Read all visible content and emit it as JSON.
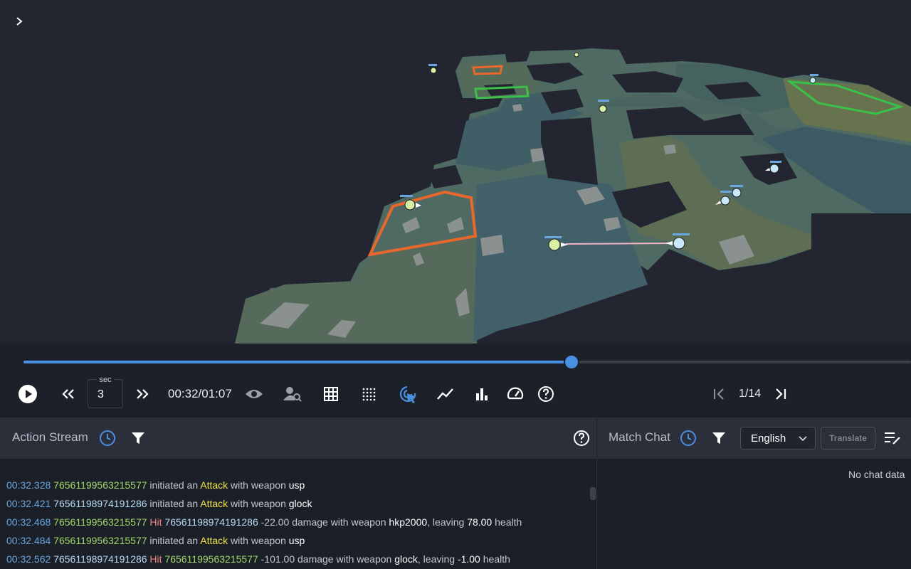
{
  "viewport": {
    "expand_icon": "chevron-right-icon",
    "player_markers": [
      {
        "team": "t",
        "color": "#d9f0a3"
      },
      {
        "team": "t",
        "color": "#d9f0a3"
      },
      {
        "team": "ct",
        "color": "#c7e9fb"
      },
      {
        "team": "ct",
        "color": "#c7e9fb"
      },
      {
        "team": "ct",
        "color": "#c7e9fb"
      },
      {
        "team": "ct",
        "color": "#c7e9fb"
      },
      {
        "team": "t",
        "color": "#d9f0a3"
      },
      {
        "team": "t",
        "color": "#d9f0a3"
      },
      {
        "team": "ct",
        "color": "#c7e9fb"
      }
    ]
  },
  "timeline": {
    "progress": 0.6175,
    "sec_label": "sec",
    "sec_value": "3",
    "timecode": "00:32/01:07",
    "page_indicator": "1/14",
    "accent": "#4a90e2"
  },
  "controls": {
    "icons": [
      "play-icon",
      "rewind-icon",
      "fast-forward-icon",
      "eye-icon",
      "user-search-icon",
      "grid-icon",
      "dot-grid-icon",
      "cursor-target-icon",
      "line-chart-icon",
      "bar-chart-icon",
      "speedometer-icon",
      "help-icon",
      "skip-first-icon",
      "skip-last-icon"
    ]
  },
  "action_stream": {
    "title": "Action Stream",
    "log": [
      [
        {
          "c": "t-time",
          "t": "00:32.328"
        },
        {
          "c": "t-p1",
          "t": " 76561199563215577"
        },
        {
          "c": "",
          "t": " initiated an "
        },
        {
          "c": "t-attack",
          "t": "Attack"
        },
        {
          "c": "",
          "t": " with weapon "
        },
        {
          "c": "t-w",
          "t": "usp"
        }
      ],
      [
        {
          "c": "t-time",
          "t": "00:32.421"
        },
        {
          "c": "t-p2",
          "t": " 76561198974191286"
        },
        {
          "c": "",
          "t": " initiated an "
        },
        {
          "c": "t-attack",
          "t": "Attack"
        },
        {
          "c": "",
          "t": " with weapon "
        },
        {
          "c": "t-w",
          "t": "glock"
        }
      ],
      [
        {
          "c": "t-time",
          "t": "00:32.468"
        },
        {
          "c": "t-p1",
          "t": " 76561199563215577"
        },
        {
          "c": "t-hit",
          "t": " Hit"
        },
        {
          "c": "t-p2",
          "t": " 76561198974191286"
        },
        {
          "c": "",
          "t": " -22.00 damage with weapon "
        },
        {
          "c": "t-w",
          "t": "hkp2000"
        },
        {
          "c": "",
          "t": ", leaving "
        },
        {
          "c": "t-w",
          "t": "78.00"
        },
        {
          "c": "",
          "t": " health"
        }
      ],
      [
        {
          "c": "t-time",
          "t": "00:32.484"
        },
        {
          "c": "t-p1",
          "t": " 76561199563215577"
        },
        {
          "c": "",
          "t": " initiated an "
        },
        {
          "c": "t-attack",
          "t": "Attack"
        },
        {
          "c": "",
          "t": " with weapon "
        },
        {
          "c": "t-w",
          "t": "usp"
        }
      ],
      [
        {
          "c": "t-time",
          "t": "00:32.562"
        },
        {
          "c": "t-p2",
          "t": " 76561198974191286"
        },
        {
          "c": "t-hit",
          "t": " Hit"
        },
        {
          "c": "t-p1",
          "t": " 76561199563215577"
        },
        {
          "c": "",
          "t": " -101.00 damage with weapon "
        },
        {
          "c": "t-w",
          "t": "glock"
        },
        {
          "c": "",
          "t": ", leaving "
        },
        {
          "c": "t-w",
          "t": "-1.00"
        },
        {
          "c": "",
          "t": " health"
        }
      ]
    ]
  },
  "match_chat": {
    "title": "Match Chat",
    "language": "English",
    "translate_label": "Translate",
    "empty_text": "No chat data"
  }
}
